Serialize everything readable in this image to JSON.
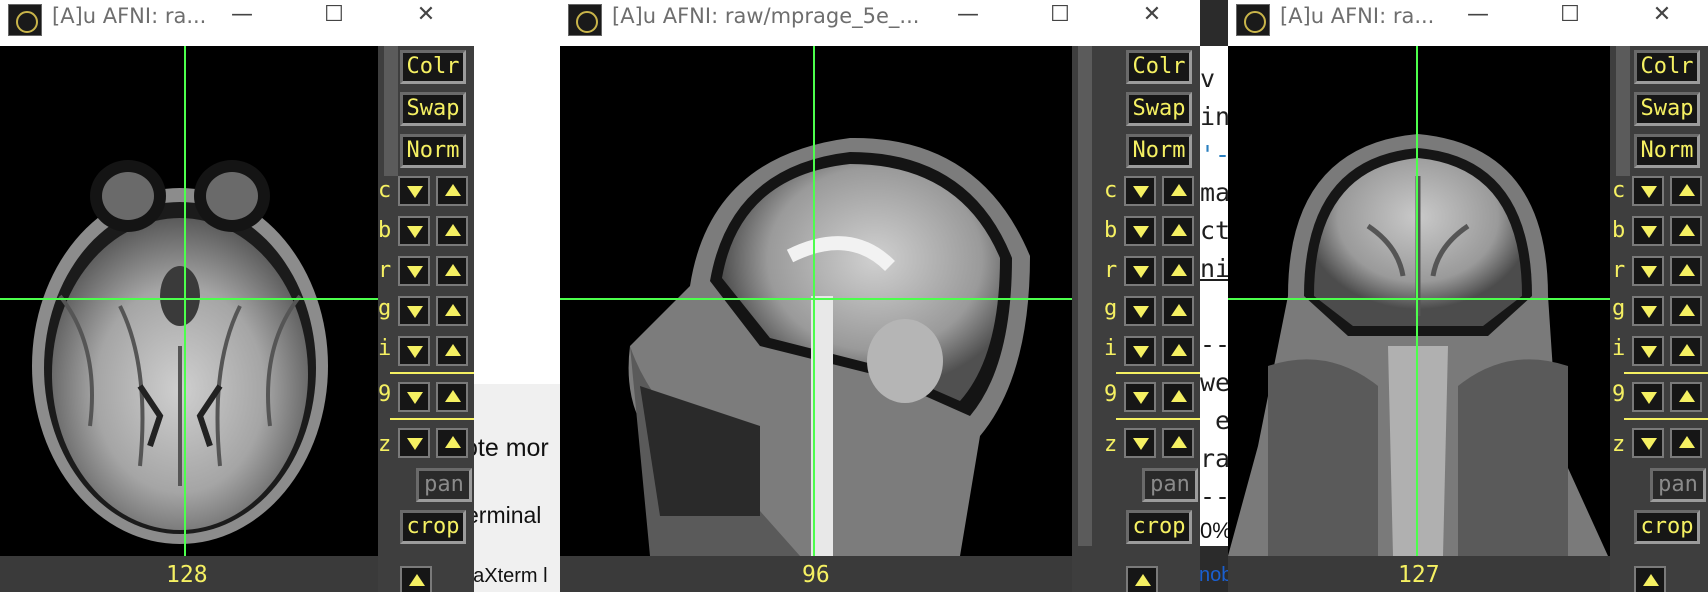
{
  "background": {
    "terminal_fragments": [
      "v",
      "in",
      "'-",
      "ma",
      "ct",
      "ni",
      "",
      "--",
      "we",
      " e",
      "ra",
      "--"
    ],
    "fragment_note_left": "ote mor",
    "fragment_terminal_left": "erminal",
    "fragment_taskbar_left": "baXterm l",
    "fragment_percent": "0%",
    "fragment_link": "nob"
  },
  "windows": [
    {
      "title": "[A]u AFNI: ra...",
      "slice_number": "128",
      "view": "axial",
      "buttons": {
        "colr": "Colr",
        "swap": "Swap",
        "norm": "Norm",
        "pan": "pan",
        "crop": "crop"
      },
      "row_labels": [
        "c",
        "b",
        "r",
        "g",
        "i",
        "9",
        "z"
      ]
    },
    {
      "title": "[A]u AFNI: raw/mprage_5e_...",
      "slice_number": "96",
      "view": "sagittal",
      "buttons": {
        "colr": "Colr",
        "swap": "Swap",
        "norm": "Norm",
        "pan": "pan",
        "crop": "crop"
      },
      "row_labels": [
        "c",
        "b",
        "r",
        "g",
        "i",
        "9",
        "z"
      ]
    },
    {
      "title": "[A]u AFNI: ra...",
      "slice_number": "127",
      "view": "coronal",
      "buttons": {
        "colr": "Colr",
        "swap": "Swap",
        "norm": "Norm",
        "pan": "pan",
        "crop": "crop"
      },
      "row_labels": [
        "c",
        "b",
        "r",
        "g",
        "i",
        "9",
        "z"
      ]
    }
  ],
  "window_controls": {
    "minimize": "—",
    "maximize": "☐",
    "close": "✕"
  },
  "colors": {
    "crosshair": "#4cff4c",
    "afni_yellow": "#f5f062",
    "panel": "#3e3e3e"
  }
}
